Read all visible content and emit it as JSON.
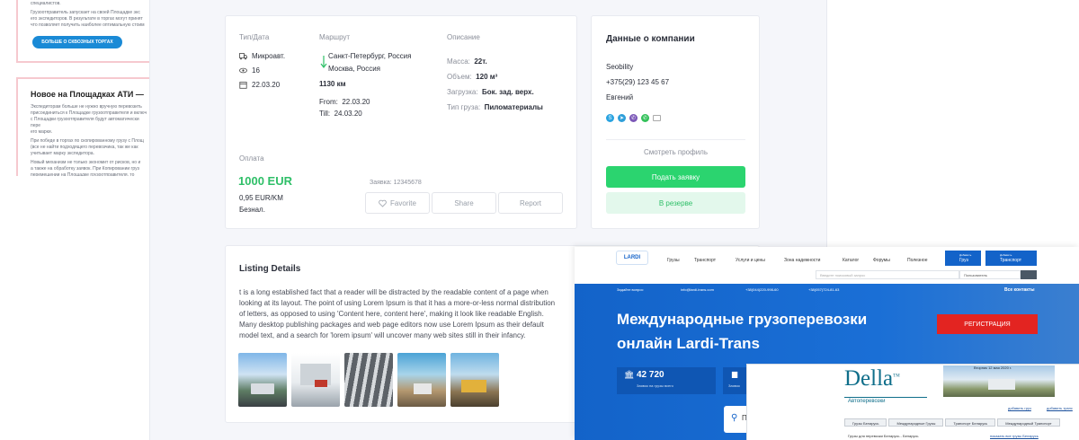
{
  "ati": {
    "top_text_1": "специалистов.",
    "top_text_2": "Грузоотправитель запускает на своей Площадке экс",
    "top_text_3": "его экспедиторов. В результате в торгах могут принят",
    "top_text_4": "что позволяет получить наиболее оптимальную стоим",
    "button_label": "БОЛЬШЕ О СКВОЗНЫХ ТОРГАХ",
    "heading": "Новое на Площадках АТИ —",
    "p1": "Экспедиторам больше не нужно вручную перевозить",
    "p2": "присоединиться к Площадке грузоотправителя и включ",
    "p3": "с Площадки грузоотправителя будут автоматически пере",
    "p4": "его марки.",
    "p5": "При победе в торгах по скопированному грузу с Площ",
    "p6": "(все не найти подходящего перевозчика, так же как",
    "p7": "учитывает марку экспедитора.",
    "p8": "Новый механизм не только экономит от рисков, но и",
    "p9": "а также на обработку заявок. При Копировании груз",
    "p10": "перемещении на Площадке грузоотправителя, то"
  },
  "listing": {
    "col_type": "Тип/Дата",
    "col_route": "Маршрут",
    "col_desc": "Описание",
    "vehicle": "Микроавт.",
    "views": "16",
    "date": "22.03.20",
    "route_from": "Санкт-Петербург, Россия",
    "route_to": "Москва, Россия",
    "distance": "1130 км",
    "from_label": "From:",
    "from_date": "22.03.20",
    "till_label": "Till:",
    "till_date": "24.03.20",
    "mass_label": "Масса:",
    "mass_value": "22т.",
    "volume_label": "Объем:",
    "volume_value": "120 м³",
    "loading_label": "Загрузка:",
    "loading_value": "Бок. зад. верх.",
    "cargo_label": "Тип груза:",
    "cargo_value": "Пиломатериалы",
    "payment_label": "Оплата",
    "price": "1000 EUR",
    "price_per_km": "0,95 EUR/KM",
    "payment_type": "Безнал.",
    "request_no": "Заявка: 12345678",
    "favorite_label": "Favorite",
    "share_label": "Share",
    "report_label": "Report"
  },
  "company": {
    "title": "Данные о компании",
    "name": "Seobility",
    "phone": "+375(29) 123 45 67",
    "contact": "Евгений",
    "view_profile": "Смотреть профиль",
    "apply": "Подать заявку",
    "reserve": "В резерве"
  },
  "details": {
    "title": "Listing Details",
    "text": "t is a long established fact that a reader will be distracted by the readable content of a page when looking at its layout. The point of using Lorem Ipsum is that it has a more-or-less normal distribution of letters, as opposed to using 'Content here, content here', making it look like readable English. Many desktop publishing packages and web page editors now use Lorem Ipsum as their default model text, and a search for 'lorem ipsum' will uncover many web sites still in their infancy."
  },
  "lardi": {
    "logo": "LARDI",
    "nav": [
      "Грузы",
      "Транспорт",
      "Услуги и цены",
      "Зона надежности",
      "Каталог",
      "Форумы",
      "Полезное"
    ],
    "add_cargo_small": "Добавить",
    "add_cargo": "Груз",
    "add_transport_small": "Добавить",
    "add_transport": "Транспорт",
    "search_placeholder": "Введите поисковый запрос",
    "user_select": "Пользователь",
    "ask": "Задайте вопрос",
    "email": "info@lardi-trans.com",
    "phone1": "+38(044)220-998-60",
    "phone2": "+38(057)724-81-63",
    "all_contacts": "Все контакты",
    "hero_line1": "Международные грузоперевозки",
    "hero_line2": "онлайн Lardi-Trans",
    "register": "РЕГИСТРАЦИЯ",
    "stat_value": "42 720",
    "stat_label": "Заявок на грузы всего",
    "stat2_label": "Заявок",
    "search_letter": "П"
  },
  "della": {
    "logo": "Della",
    "tm": "TM",
    "subtitle": "Автоперевозки",
    "date_banner": "Вторник 12 мая 2020 г.",
    "link1": "добавить груз",
    "link2": "добавить транс",
    "tabs": [
      "Грузы Беларусь",
      "Международные Грузы",
      "Транспорт Беларусь",
      "Международный Транспорт"
    ],
    "sub1": "Грузы для перевозки Беларусь - Беларусь",
    "sub2": "показать все грузы Беларусь"
  },
  "colors": {
    "accent_green": "#2fbf68",
    "lardi_blue": "#1363c9",
    "lardi_red": "#e32421",
    "della_teal": "#0f6e8a",
    "ati_blue": "#1a8ad6"
  }
}
